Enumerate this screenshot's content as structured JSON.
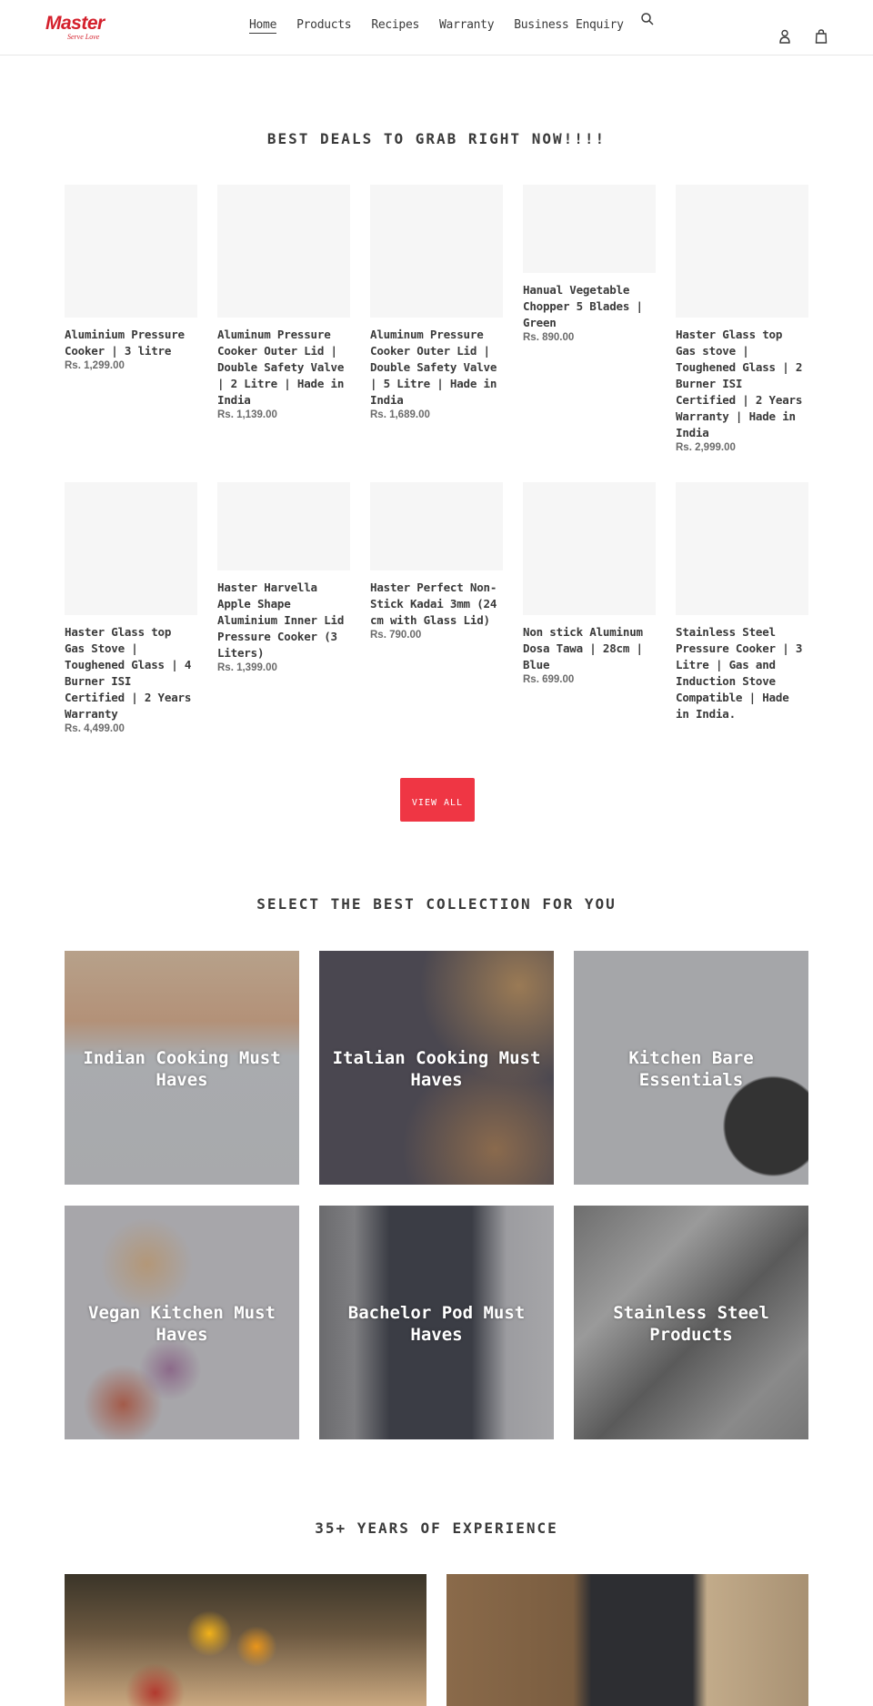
{
  "header": {
    "logo_text": "Master",
    "logo_tagline": "Serve Love",
    "nav": [
      {
        "label": "Home",
        "active": true
      },
      {
        "label": "Products"
      },
      {
        "label": "Recipes"
      },
      {
        "label": "Warranty"
      },
      {
        "label": "Business Enquiry"
      }
    ],
    "icons": [
      "search-icon",
      "user-icon",
      "cart-icon"
    ]
  },
  "deals": {
    "title": "BEST DEALS TO GRAB RIGHT NOW!!!!",
    "products": [
      {
        "name": "Aluminium Pressure Cooker | 3 litre",
        "price": "Rs. 1,299.00"
      },
      {
        "name": "Aluminum Pressure Cooker Outer Lid | Double Safety Valve | 2 Litre | Hade in India",
        "price": "Rs. 1,139.00"
      },
      {
        "name": "Aluminum Pressure Cooker Outer Lid | Double Safety Valve | 5 Litre | Hade in India",
        "price": "Rs. 1,689.00"
      },
      {
        "name": "Hanual Vegetable Chopper 5 Blades | Green",
        "price": "Rs. 890.00"
      },
      {
        "name": "Haster Glass top Gas stove | Toughened Glass | 2 Burner ISI Certified | 2 Years Warranty | Hade in India",
        "price": "Rs. 2,999.00"
      },
      {
        "name": "Haster Glass top Gas Stove | Toughened Glass | 4 Burner ISI Certified | 2 Years Warranty",
        "price": "Rs. 4,499.00"
      },
      {
        "name": "Haster Harvella Apple Shape Aluminium Inner Lid Pressure Cooker (3 Liters)",
        "price": "Rs. 1,399.00"
      },
      {
        "name": "Haster Perfect Non-Stick Kadai 3mm (24 cm with Glass Lid)",
        "price": "Rs. 790.00"
      },
      {
        "name": "Non stick Aluminum Dosa Tawa | 28cm | Blue",
        "price": "Rs. 699.00"
      },
      {
        "name": "Stainless Steel Pressure Cooker | 3 Litre | Gas and Induction Stove Compatible | Hade in India.",
        "price": ""
      }
    ],
    "view_all_label": "VIEW ALL"
  },
  "collections": {
    "title": "SELECT THE BEST COLLECTION FOR YOU",
    "items": [
      {
        "label": "Indian Cooking Must Haves"
      },
      {
        "label": "Italian Cooking Must Haves"
      },
      {
        "label": "Kitchen Bare Essentials"
      },
      {
        "label": "Vegan Kitchen Must Haves"
      },
      {
        "label": "Bachelor Pod Must Haves"
      },
      {
        "label": "Stainless Steel Products"
      }
    ]
  },
  "experience": {
    "title": "35+ YEARS OF EXPERIENCE"
  },
  "colors": {
    "brand_red": "#d4202c",
    "button_red": "#ef3644",
    "placeholder": "#f6f6f6"
  }
}
